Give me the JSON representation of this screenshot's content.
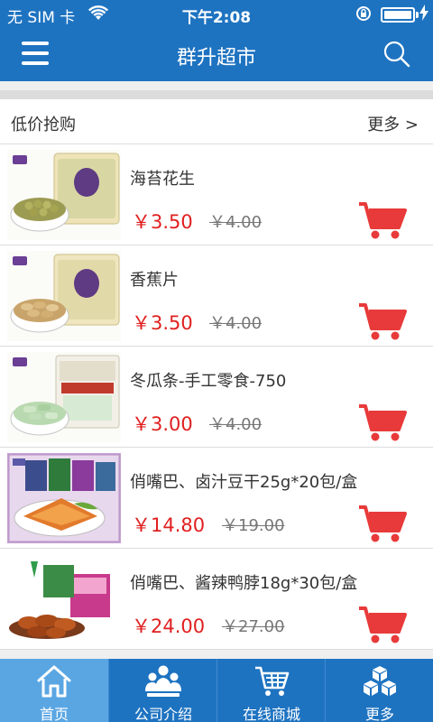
{
  "status_bar": {
    "carrier": "无 SIM 卡",
    "time": "下午2:08",
    "battery_level": 1.0
  },
  "nav": {
    "title": "群升超市"
  },
  "section": {
    "title": "低价抢购",
    "more_label": "更多 >"
  },
  "products": [
    {
      "name": "海苔花生",
      "price": "￥3.50",
      "old_price": "￥4.00"
    },
    {
      "name": "香蕉片",
      "price": "￥3.50",
      "old_price": "￥4.00"
    },
    {
      "name": "冬瓜条-手工零食-750",
      "price": "￥3.00",
      "old_price": "￥4.00"
    },
    {
      "name": "俏嘴巴、卤汁豆干25g*20包/盒",
      "price": "￥14.80",
      "old_price": "￥19.00"
    },
    {
      "name": "俏嘴巴、酱辣鸭脖18g*30包/盒",
      "price": "￥24.00",
      "old_price": "￥27.00"
    }
  ],
  "tabs": [
    {
      "label": "首页",
      "icon": "home-icon",
      "active": true
    },
    {
      "label": "公司介绍",
      "icon": "people-icon",
      "active": false
    },
    {
      "label": "在线商城",
      "icon": "cart-icon",
      "active": false
    },
    {
      "label": "更多",
      "icon": "cubes-icon",
      "active": false
    }
  ],
  "colors": {
    "primary": "#1e73c1",
    "active_tab": "#5aa6e3",
    "price": "#e02020",
    "cart": "#e83a3a"
  }
}
